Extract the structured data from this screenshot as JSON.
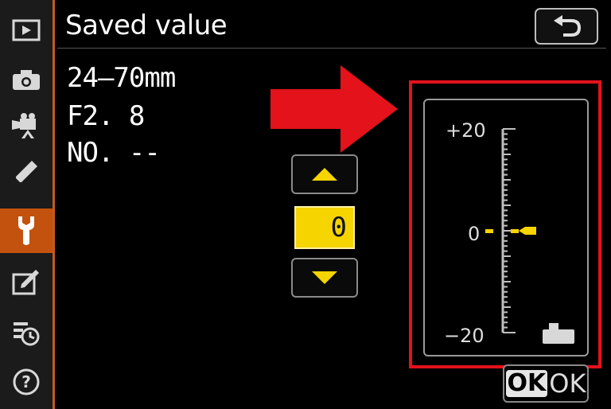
{
  "header": {
    "title": "Saved value"
  },
  "lens": {
    "focal_length": "24–70mm",
    "aperture": "F2. 8",
    "number": "NO. --"
  },
  "stepper": {
    "value": "0"
  },
  "gauge": {
    "max_label": "+20",
    "zero_label": "0",
    "min_label": "−20",
    "max": 20,
    "min": -20,
    "current": 0
  },
  "footer": {
    "ok_badge": "OK",
    "ok_label": "OK"
  },
  "sidebar": {
    "items": [
      {
        "name": "playback",
        "icon": "playback-icon"
      },
      {
        "name": "photo-shooting",
        "icon": "camera-icon"
      },
      {
        "name": "movie-shooting",
        "icon": "movie-camera-icon"
      },
      {
        "name": "custom-settings",
        "icon": "pencil-icon"
      },
      {
        "name": "setup",
        "icon": "wrench-icon",
        "active": true
      },
      {
        "name": "retouch",
        "icon": "retouch-icon"
      },
      {
        "name": "my-menu",
        "icon": "my-menu-icon"
      },
      {
        "name": "help",
        "icon": "help-icon"
      }
    ]
  },
  "colors": {
    "accent": "#c4520f",
    "highlight": "#f5d400",
    "annotation_red": "#e3121b"
  }
}
